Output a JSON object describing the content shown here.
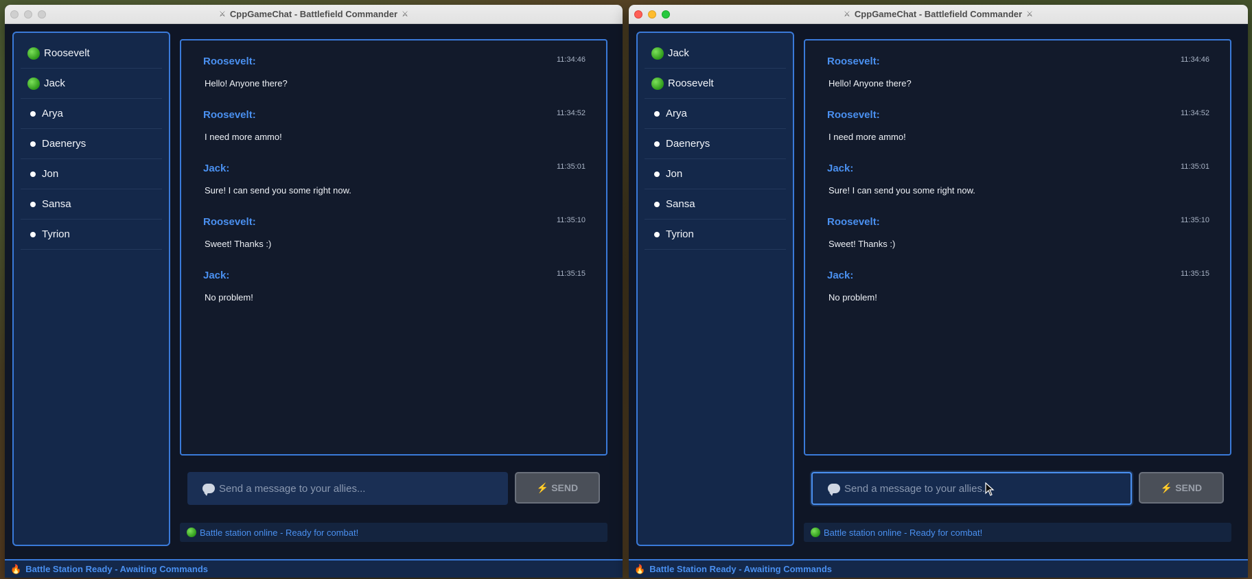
{
  "windows": [
    {
      "title": "CppGameChat - Battlefield Commander",
      "users": [
        {
          "name": "Roosevelt",
          "online": true
        },
        {
          "name": "Jack",
          "online": true
        },
        {
          "name": "Arya",
          "online": false
        },
        {
          "name": "Daenerys",
          "online": false
        },
        {
          "name": "Jon",
          "online": false
        },
        {
          "name": "Sansa",
          "online": false
        },
        {
          "name": "Tyrion",
          "online": false
        }
      ]
    },
    {
      "title": "CppGameChat - Battlefield Commander",
      "users": [
        {
          "name": "Jack",
          "online": true
        },
        {
          "name": "Roosevelt",
          "online": true
        },
        {
          "name": "Arya",
          "online": false
        },
        {
          "name": "Daenerys",
          "online": false
        },
        {
          "name": "Jon",
          "online": false
        },
        {
          "name": "Sansa",
          "online": false
        },
        {
          "name": "Tyrion",
          "online": false
        }
      ]
    }
  ],
  "messages": [
    {
      "sender": "Roosevelt:",
      "time": "11:34:46",
      "text": "Hello! Anyone there?"
    },
    {
      "sender": "Roosevelt:",
      "time": "11:34:52",
      "text": "I need more ammo!"
    },
    {
      "sender": "Jack:",
      "time": "11:35:01",
      "text": "Sure! I can send you some right now."
    },
    {
      "sender": "Roosevelt:",
      "time": "11:35:10",
      "text": "Sweet! Thanks :)"
    },
    {
      "sender": "Jack:",
      "time": "11:35:15",
      "text": "No problem!"
    }
  ],
  "input": {
    "placeholder": "Send a message to your allies..."
  },
  "send_label": "⚡ SEND",
  "status_text": "Battle station online - Ready for combat!",
  "footer_text": "Battle Station Ready - Awaiting Commands",
  "colors": {
    "accent": "#4a90f0",
    "panel": "#14284a",
    "online": "#2e9a1a"
  }
}
